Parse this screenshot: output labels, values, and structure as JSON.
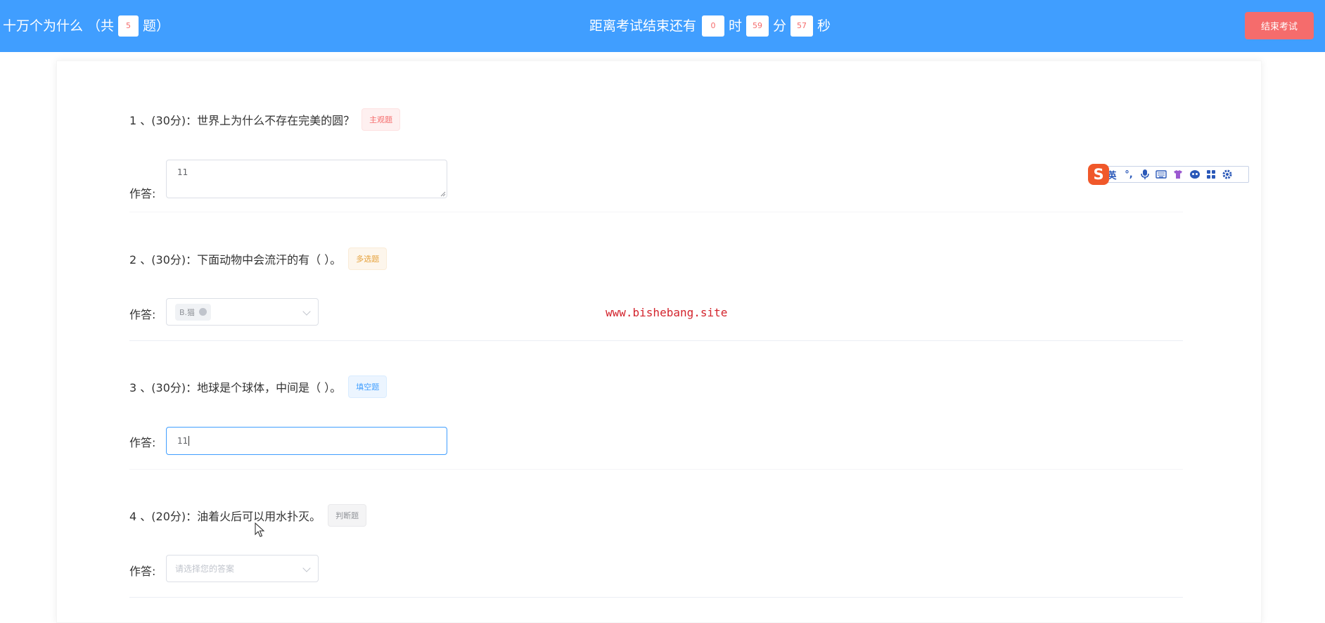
{
  "header": {
    "exam_title": "十万个为什么 （共",
    "question_count": "5",
    "title_suffix": "题）",
    "countdown_prefix": "距离考试结束还有",
    "hours": "0",
    "hours_unit": "时",
    "minutes": "59",
    "minutes_unit": "分",
    "seconds": "57",
    "seconds_unit": "秒",
    "end_button": "结束考试"
  },
  "answer_label": "作答:",
  "questions": [
    {
      "text": "1 、(30分)：世界上为什么不存在完美的圆？",
      "tag": "主观题",
      "answer_value": "11"
    },
    {
      "text": "2 、(30分)：下面动物中会流汗的有（ ）。",
      "tag": "多选题",
      "selected_chip": "B.猫"
    },
    {
      "text": "3 、(30分)：地球是个球体，中间是（ ）。",
      "tag": "填空题",
      "answer_value": "11"
    },
    {
      "text": "4 、(20分)：油着火后可以用水扑灭。",
      "tag": "判断题",
      "placeholder": "请选择您的答案"
    }
  ],
  "watermark": "www.bishebang.site",
  "ime_toolbar": {
    "logo": "S",
    "items": [
      "英",
      "°,",
      "mic-icon",
      "keyboard-icon",
      "skin-icon",
      "emoji-icon",
      "apps-icon",
      "settings-icon"
    ],
    "english_label": "英",
    "punct_label": "°,"
  },
  "colors": {
    "header_bg": "#409eff",
    "end_button_bg": "#f56c6c",
    "watermark": "#d3242d",
    "focus_border": "#409eff"
  }
}
